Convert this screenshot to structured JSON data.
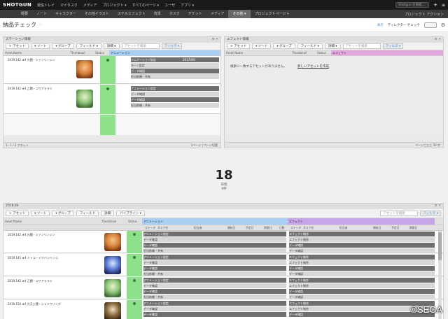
{
  "topbar": {
    "logo": "SHOTGUN",
    "items": [
      "受信トレイ",
      "マイタスク",
      "メディア",
      "プロジェクト ▾",
      "すべてのページ ▾",
      "ユーザ",
      "アプリ ▾"
    ],
    "search_placeholder": "Shotgun を検索..."
  },
  "nav": {
    "tabs": [
      "概要",
      "ノート",
      "キャラクター",
      "その他イラスト",
      "ステルエフェクト",
      "背景",
      "タスク",
      "チケット",
      "メディア",
      "その他 ▾",
      "プロジェクトページ ▾"
    ],
    "active_index": 9,
    "right": "プロジェクト アクション"
  },
  "page": {
    "title": "納品チェック",
    "right_links": [
      "表示",
      "ディレクター チェック"
    ]
  },
  "panel_left": {
    "title": "ステーション情報",
    "toolbar": [
      "+ アセット",
      "▾ ソート",
      "▾ グループ",
      "フィールド ▾",
      "詳細 ▾"
    ],
    "search_placeholder": "アセットを検索",
    "filter": "フィルタ ▾",
    "columns": [
      "Asset Name",
      "Thumbnail",
      "Status",
      "ステータス",
      "タスク名",
      "担当者",
      "開始日"
    ],
    "section": "アニメーション",
    "rows": [
      {
        "name": "2019.142 ★4 光闘・ツァンリンジン",
        "tasks": [
          "アニメーション設定",
          "ターン設定",
          "データ確認",
          "担当依頼・共有"
        ],
        "assignees": [
          "",
          "",
          "",
          ""
        ],
        "dates": [
          "2017/09/",
          "2017/09/",
          "2017/09/",
          "2017/09/"
        ]
      },
      {
        "name": "2019.142 ★4 乙闘・コワアララツ",
        "tasks": [
          "アニメーション設定",
          "データ確認",
          "データ確認",
          "担当依頼・共有"
        ],
        "assignees": [
          "",
          "",
          "",
          ""
        ],
        "dates": [
          "2017/09/",
          "2017/09/",
          "2017/09/",
          "2017/09/"
        ]
      }
    ],
    "footer": "1 - 1 / 2 アセット",
    "footer_right": "1ページ | ページ切替"
  },
  "panel_right": {
    "title": "エフェクト情報",
    "toolbar": [
      "+ アセット",
      "▾ ソート",
      "▾ グループ",
      "フィールド ▾",
      "詳細 ▾"
    ],
    "search_placeholder": "アセットを検索",
    "filter": "フィルタ ▾",
    "columns": [
      "Asset Name",
      "Thumbnail",
      "Status",
      "ステータス",
      "タスク名",
      "担当者",
      "開始日"
    ],
    "section": "エフェクト",
    "empty": "検索に一致するアセットがありません。",
    "empty_link": "新しいアセットを作成",
    "footer_right": "ページごとに 50 件"
  },
  "stats": {
    "number": "18",
    "sub1": "日程",
    "sub2": "9件"
  },
  "bottom_panel": {
    "title": "2018.04",
    "toolbar": [
      "+ アセット",
      "▾ ソート",
      "▾ グループ",
      "フィールド",
      "詳細",
      "パイプライン ▾"
    ],
    "search_placeholder": "アセットを検索",
    "filter": "フィルタ ▾",
    "columns": [
      "Asset Name",
      "Thumbnail",
      "Status"
    ],
    "sec_anim": "アニメーション",
    "sec_fx": "エフェクト",
    "anim_cols": [
      "ステータス",
      "タスク名",
      "担当者",
      "開始日",
      "予定日",
      "期限日",
      "日数"
    ],
    "fx_cols": [
      "ステータス",
      "タスク名",
      "担当者",
      "開始日",
      "予定日",
      "期限日",
      "日数"
    ],
    "rows": [
      {
        "name": "2019.142 ★4 光闘・ツァンリンジン",
        "anim": [
          "アニメーション設定",
          "データ確認",
          "データ確認",
          "担当依頼・共有"
        ],
        "fx": [
          "エフェクト制作",
          "エフェクト制作",
          "データ確認",
          "データ確認"
        ]
      },
      {
        "name": "2019.145 ★4 ミトコ・イツバンリンジ",
        "anim": [
          "アニメーション設定",
          "データ確認",
          "データ確認",
          "担当依頼・共有"
        ],
        "fx": [
          "エフェクト制作",
          "エフェクト制作",
          "データ確認",
          "データ確認"
        ]
      },
      {
        "name": "2019.142 ★4 乙闘・コワアララツ",
        "anim": [
          "アニメーション設定",
          "データ確認",
          "データ確認",
          "担当依頼・共有"
        ],
        "fx": [
          "エフェクト制作",
          "エフェクト制作",
          "データ確認",
          "データ確認"
        ]
      },
      {
        "name": "2019.150 ★4 光天土闘・シャドウリング",
        "anim": [
          "アニメーション設定",
          "データ確認",
          "データ確認",
          "担当依頼・共有"
        ],
        "fx": [
          "エフェクト制作",
          "エフェクト制作",
          "データ確認",
          "データ確認"
        ]
      }
    ]
  },
  "watermark": "©SEGA",
  "colors": {
    "status_green": "#8fe08a",
    "accent_blue": "#3a8ed8",
    "fx_purple": "#c7a6e7",
    "anim_blue": "#a9d0f2"
  }
}
